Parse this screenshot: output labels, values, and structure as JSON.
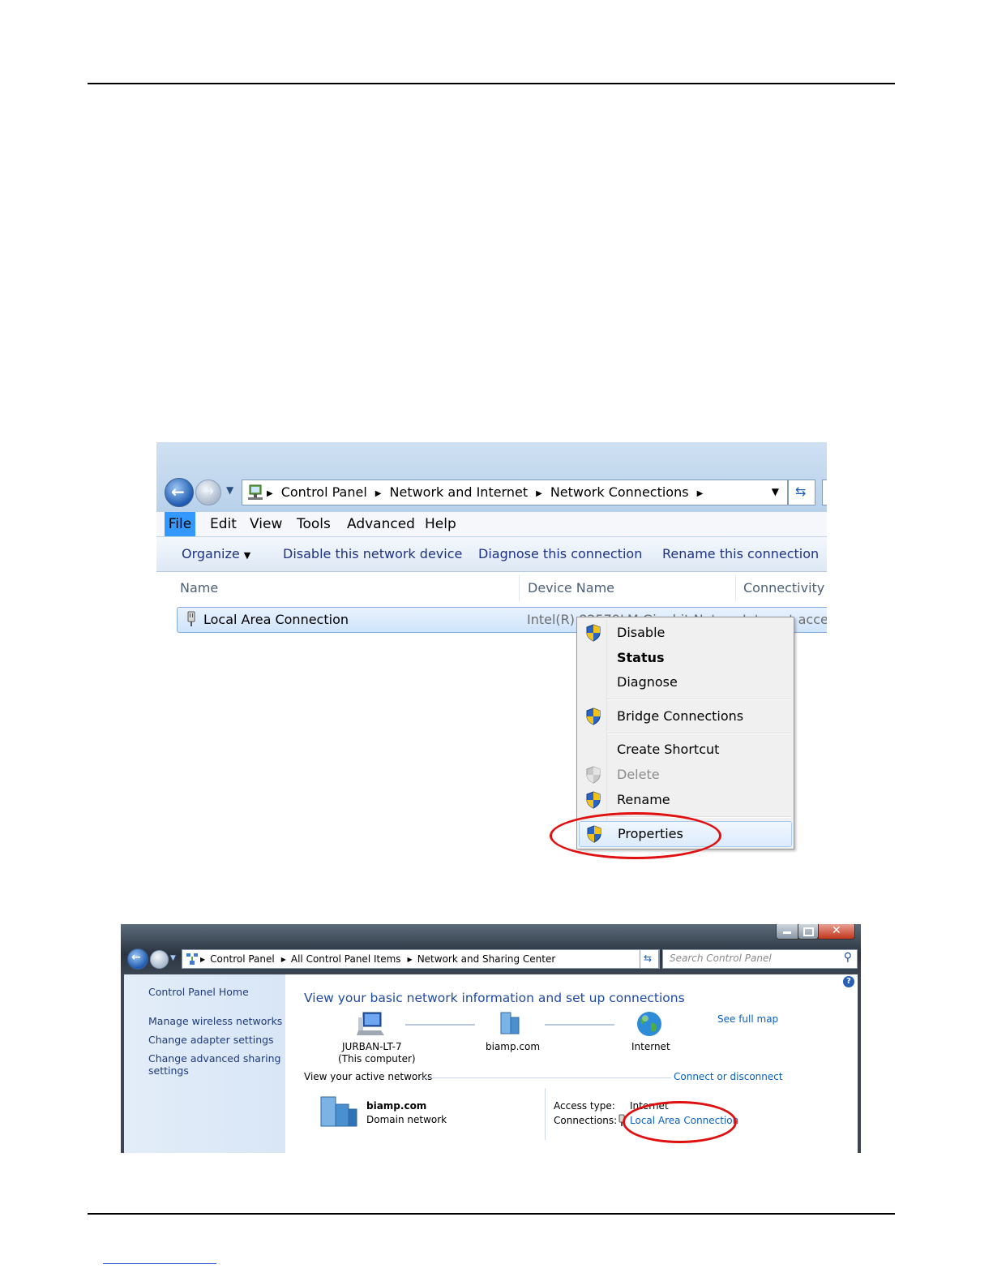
{
  "nc_window": {
    "breadcrumb": [
      "Control Panel",
      "Network and Internet",
      "Network Connections"
    ],
    "menus": [
      "File",
      "Edit",
      "View",
      "Tools",
      "Advanced",
      "Help"
    ],
    "commands": {
      "organize": "Organize",
      "disable": "Disable this network device",
      "diagnose": "Diagnose this connection",
      "rename": "Rename this connection"
    },
    "columns": [
      "Name",
      "Device Name",
      "Connectivity"
    ],
    "row": {
      "name": "Local Area Connection",
      "device": "Intel(R) 82579LM Gigabit Net",
      "connectivity": "Internet access"
    }
  },
  "context_menu": {
    "items": [
      "Disable",
      "Status",
      "Diagnose",
      "Bridge Connections",
      "Create Shortcut",
      "Delete",
      "Rename",
      "Properties"
    ]
  },
  "nsc_window": {
    "breadcrumb": [
      "Control Panel",
      "All Control Panel Items",
      "Network and Sharing Center"
    ],
    "search_placeholder": "Search Control Panel",
    "sidebar": {
      "home": "Control Panel Home",
      "links": [
        "Manage wireless networks",
        "Change adapter settings",
        "Change advanced sharing",
        "settings"
      ]
    },
    "heading": "View your basic network information and set up connections",
    "see_full_map": "See full map",
    "map": {
      "computer_name": "JURBAN-LT-7",
      "computer_sub": "(This computer)",
      "domain": "biamp.com",
      "internet": "Internet"
    },
    "active_networks_label": "View your active networks",
    "connect_disconnect": "Connect or disconnect",
    "network": {
      "name": "biamp.com",
      "type": "Domain network"
    },
    "access_type_label": "Access type:",
    "access_type_value": "Internet",
    "connections_label": "Connections:",
    "connections_value": "Local Area Connection"
  },
  "colors": {
    "highlight": "#e01010",
    "link": "#0a60c0",
    "menu_selected": "#3399ff"
  }
}
